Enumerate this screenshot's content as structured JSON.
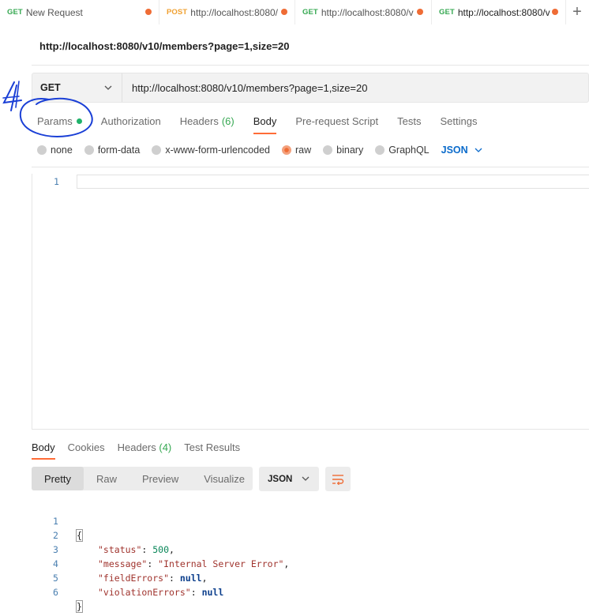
{
  "tabs": [
    {
      "method": "GET",
      "title": "New Request"
    },
    {
      "method": "POST",
      "title": "http://localhost:8080/"
    },
    {
      "method": "GET",
      "title": "http://localhost:8080/v"
    },
    {
      "method": "GET",
      "title": "http://localhost:8080/v"
    }
  ],
  "new_tab_label": "+",
  "request": {
    "name": "http://localhost:8080/v10/members?page=1,size=20",
    "method": "GET",
    "url": "http://localhost:8080/v10/members?page=1,size=20"
  },
  "request_tabs": {
    "params": "Params",
    "authorization": "Authorization",
    "headers": "Headers",
    "headers_count": "(6)",
    "body": "Body",
    "prerequest": "Pre-request Script",
    "tests": "Tests",
    "settings": "Settings"
  },
  "body_types": {
    "none": "none",
    "form_data": "form-data",
    "urlencoded": "x-www-form-urlencoded",
    "raw": "raw",
    "binary": "binary",
    "graphql": "GraphQL",
    "language": "JSON"
  },
  "editor": {
    "line_number": "1"
  },
  "response_tabs": {
    "body": "Body",
    "cookies": "Cookies",
    "headers": "Headers",
    "headers_count": "(4)",
    "test_results": "Test Results"
  },
  "view_modes": {
    "pretty": "Pretty",
    "raw": "Raw",
    "preview": "Preview",
    "visualize": "Visualize"
  },
  "format": "JSON",
  "response_body": {
    "ln1": "1",
    "ln2": "2",
    "ln3": "3",
    "ln4": "4",
    "ln5": "5",
    "ln6": "6",
    "open_brace": "{",
    "close_brace": "}",
    "status_key": "\"status\"",
    "status_val": "500",
    "message_key": "\"message\"",
    "message_val": "\"Internal Server Error\"",
    "field_key": "\"fieldErrors\"",
    "field_val": "null",
    "violation_key": "\"violationErrors\"",
    "violation_val": "null"
  },
  "colors": {
    "accent": "#ff6c37",
    "get": "#36a852",
    "post": "#f0a030",
    "annotation": "#1a3fd6"
  }
}
